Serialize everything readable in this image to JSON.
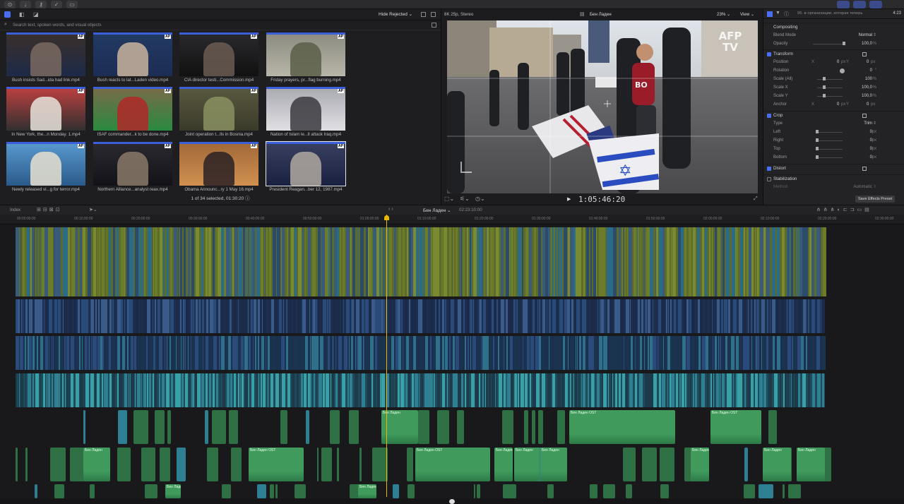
{
  "browser": {
    "filter_label": "Hide Rejected",
    "search_placeholder": "Search text, spoken words, and visual objects",
    "selection_status": "1 of 34 selected, 01:30:20",
    "clips": [
      {
        "caption": "Bush insists Sad...ida had link.mp4",
        "colors": [
          "#3b2f2a",
          "#7a6a60",
          "#1d2a48"
        ]
      },
      {
        "caption": "Bush reacts to lat...Laden video.mp4",
        "colors": [
          "#223a62",
          "#c9b49d",
          "#1c2d54"
        ]
      },
      {
        "caption": "CIA director testi...Commission.mp4",
        "colors": [
          "#2a2a2e",
          "#6a5c52",
          "#111"
        ]
      },
      {
        "caption": "Friday prayers, pr...flag burning.mp4",
        "colors": [
          "#8a8a80",
          "#5a5e48",
          "#b8b6a8"
        ]
      },
      {
        "caption": "In New York, the...n Monday. 1.mp4",
        "colors": [
          "#c04040",
          "#e8e4dc",
          "#303030"
        ]
      },
      {
        "caption": "ISAF commander...k to be done.mp4",
        "colors": [
          "#7a6a48",
          "#b02828",
          "#2a8a40"
        ]
      },
      {
        "caption": "Joint operation t...lls in Bosnia.mp4",
        "colors": [
          "#5a5a40",
          "#8a9060",
          "#3a3a2a"
        ]
      },
      {
        "caption": "Nation of Islam le...ll attack Iraq.mp4",
        "colors": [
          "#a8a8b0",
          "#3a3a40",
          "#e0e0e4"
        ]
      },
      {
        "caption": "Newly released vi...g for terror.mp4",
        "colors": [
          "#5a9ad0",
          "#e8e0d0",
          "#2a5a8a"
        ]
      },
      {
        "caption": "Northern Alliance...analyst reax.mp4",
        "colors": [
          "#2a2a30",
          "#8a7a6a",
          "#121218"
        ]
      },
      {
        "caption": "Obama Announc...ry 1 May 16.mp4",
        "colors": [
          "#a06838",
          "#2a2024",
          "#d09050"
        ]
      },
      {
        "caption": "President Reagan...ber 12, 1987.mp4",
        "colors": [
          "#3a4060",
          "#b0a8a0",
          "#1a2040"
        ]
      }
    ]
  },
  "viewer": {
    "format": "8K 25p, Stereo",
    "clip_name": "Бен Ладен",
    "zoom": "23%",
    "view_menu": "View",
    "timecode": "1:05:46:20",
    "watermark": "AFP TV"
  },
  "inspector": {
    "header_text": "95. в организации, которая теперь",
    "duration": "4:23",
    "compositing": "Compositing",
    "blend_mode_label": "Blend Mode",
    "blend_mode_value": "Normal",
    "opacity_label": "Opacity",
    "opacity_value": "100,0",
    "transform": "Transform",
    "position_label": "Position",
    "position_x": "0",
    "position_y": "0",
    "rotation_label": "Rotation",
    "rotation_value": "0",
    "scale_all_label": "Scale (All)",
    "scale_all_value": "100",
    "scale_x_label": "Scale X",
    "scale_x_value": "100,0",
    "scale_y_label": "Scale Y",
    "scale_y_value": "100,0",
    "anchor_label": "Anchor",
    "anchor_x": "0",
    "anchor_y": "0",
    "crop": "Crop",
    "type_label": "Type",
    "type_value": "Trim",
    "left_label": "Left",
    "left_value": "0",
    "right_label": "Right",
    "right_value": "0",
    "top_label": "Top",
    "top_value": "0",
    "bottom_label": "Bottom",
    "bottom_value": "0",
    "distort": "Distort",
    "stabilization": "Stabilization",
    "method_label": "Method",
    "method_value": "Automatic",
    "save_preset": "Save Effects Preset",
    "px": "px",
    "pct": "%",
    "deg": "°",
    "x": "X",
    "y": "Y"
  },
  "timeline": {
    "index_label": "Index",
    "project_name": "Бен Ладен",
    "project_duration": "02:23:10:00",
    "ruler": [
      "00:00:00:00",
      "00:10:00:00",
      "00:20:00:00",
      "00:30:00:00",
      "00:40:00:00",
      "00:50:00:00",
      "01:00:00:00",
      "01:10:00:00",
      "01:20:00:00",
      "01:30:00:00",
      "01:40:00:00",
      "01:50:00:00",
      "02:00:00:00",
      "02:10:00:00",
      "02:20:00:00",
      "02:30:00:00"
    ],
    "audio_clip_label": "Бен Ладен",
    "audio_clip_label_ost": "Бен Ладен OST"
  },
  "colors": {
    "accent": "#4b6ef0",
    "playhead": "#e8b800",
    "clip_green": "#3f9a5c",
    "clip_teal": "#2e7f92",
    "clip_blue": "#243a66"
  }
}
